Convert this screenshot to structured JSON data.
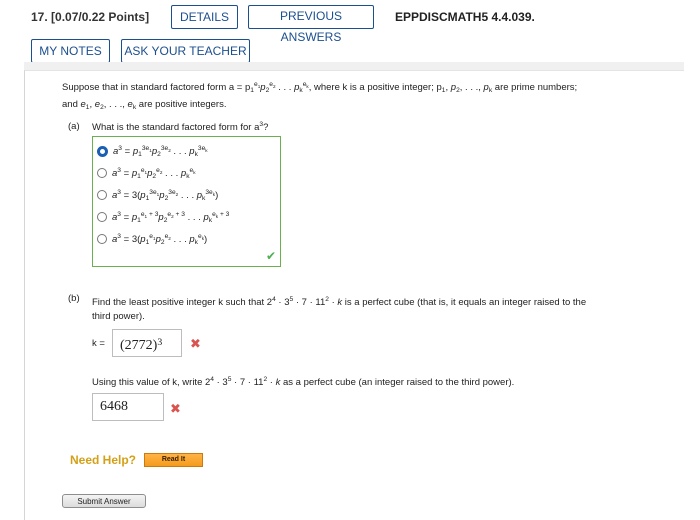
{
  "header": {
    "question_number": "17.",
    "points": "[0.07/0.22 Points]",
    "details_label": "DETAILS",
    "previous_answers_label": "PREVIOUS ANSWERS",
    "question_id": "EPPDISCMATH5 4.4.039.",
    "my_notes_label": "MY NOTES",
    "ask_teacher_label": "ASK YOUR TEACHER"
  },
  "problem": {
    "statement_prefix": "Suppose that in standard factored form a = p",
    "statement_middle": ", where k is a positive integer; p",
    "statement_tail": " are prime numbers;",
    "statement_line2_tail": " are positive integers."
  },
  "part_a": {
    "label": "(a)",
    "question": "What is the standard factored form for a",
    "selected_index": 0,
    "correct": true
  },
  "part_b": {
    "label": "(b)",
    "question_prefix": "Find the least positive integer k such that 2",
    "question_suffix": " is a perfect cube (that is, it equals an integer raised to the",
    "question_line2": "third power).",
    "k_label": "k =",
    "k_answer": "(2772)",
    "k_answer_exp": "3",
    "k_correct": false,
    "using_text": "Using this value of k, write 2",
    "using_suffix": " as a perfect cube (an integer raised to the third power).",
    "cube_answer": "6468",
    "cube_correct": false
  },
  "help": {
    "need_help_label": "Need Help?",
    "read_it_label": "Read It"
  },
  "submit_label": "Submit Answer",
  "colors": {
    "accent": "#1c4f8f",
    "correct": "#4caf50",
    "incorrect": "#d9534f",
    "help": "#d4a017"
  }
}
